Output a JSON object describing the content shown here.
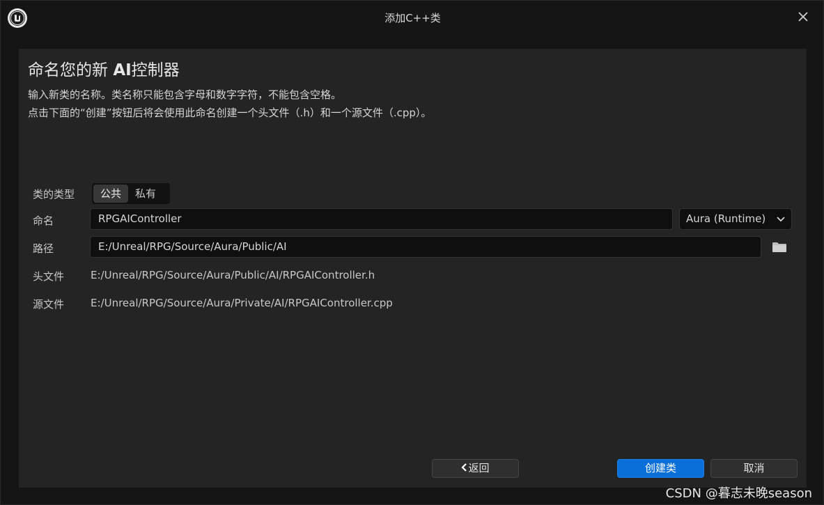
{
  "window": {
    "title": "添加C++类",
    "logo_icon": "unreal-engine-logo",
    "close_icon": "close-icon"
  },
  "header": {
    "heading_prefix": "命名您的新 ",
    "heading_bold": "AI",
    "heading_suffix": "控制器",
    "description_line1": "输入新类的名称。类名称只能包含字母和数字字符，不能包含空格。",
    "description_line2": "点击下面的“创建”按钮后将会使用此命名创建一个头文件（.h）和一个源文件（.cpp）。"
  },
  "form": {
    "class_type_label": "类的类型",
    "class_type_options": [
      "公共",
      "私有"
    ],
    "class_type_selected": "公共",
    "name_label": "命名",
    "name_value": "RPGAIController",
    "module_value": "Aura (Runtime)",
    "path_label": "路径",
    "path_value": "E:/Unreal/RPG/Source/Aura/Public/AI",
    "header_file_label": "头文件",
    "header_file_value": "E:/Unreal/RPG/Source/Aura/Public/AI/RPGAIController.h",
    "source_file_label": "源文件",
    "source_file_value": "E:/Unreal/RPG/Source/Aura/Private/AI/RPGAIController.cpp"
  },
  "buttons": {
    "back_label": "返回",
    "create_label": "创建类",
    "cancel_label": "取消"
  },
  "colors": {
    "accent": "#0a6fd8",
    "panel_bg": "#242424",
    "window_bg": "#151515"
  },
  "watermark": "CSDN @暮志未晚season"
}
